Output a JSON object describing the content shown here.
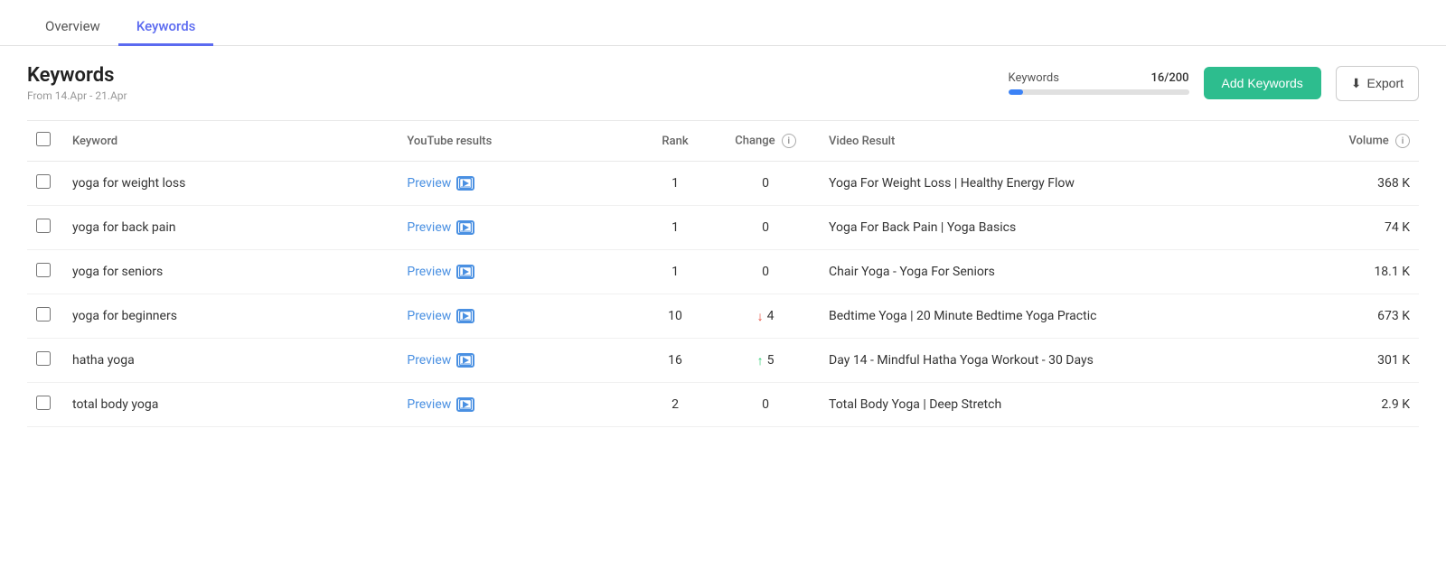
{
  "tabs": [
    {
      "id": "overview",
      "label": "Overview",
      "active": false
    },
    {
      "id": "keywords",
      "label": "Keywords",
      "active": true
    }
  ],
  "page": {
    "title": "Keywords",
    "date_range": "From 14.Apr - 21.Apr"
  },
  "keywords_counter": {
    "label": "Keywords",
    "current": "16/200",
    "progress_percent": 8
  },
  "buttons": {
    "add_keywords": "Add Keywords",
    "export": "Export"
  },
  "table": {
    "columns": [
      {
        "id": "checkbox",
        "label": ""
      },
      {
        "id": "keyword",
        "label": "Keyword"
      },
      {
        "id": "youtube_results",
        "label": "YouTube results"
      },
      {
        "id": "rank",
        "label": "Rank"
      },
      {
        "id": "change",
        "label": "Change"
      },
      {
        "id": "video_result",
        "label": "Video Result"
      },
      {
        "id": "volume",
        "label": "Volume"
      }
    ],
    "rows": [
      {
        "keyword": "yoga for weight loss",
        "rank": "1",
        "change_value": "0",
        "change_direction": "none",
        "video_result": "Yoga For Weight Loss | Healthy Energy Flow",
        "volume": "368 K"
      },
      {
        "keyword": "yoga for back pain",
        "rank": "1",
        "change_value": "0",
        "change_direction": "none",
        "video_result": "Yoga For Back Pain | Yoga Basics",
        "volume": "74 K"
      },
      {
        "keyword": "yoga for seniors",
        "rank": "1",
        "change_value": "0",
        "change_direction": "none",
        "video_result": "Chair Yoga - Yoga For Seniors",
        "volume": "18.1 K"
      },
      {
        "keyword": "yoga for beginners",
        "rank": "10",
        "change_value": "4",
        "change_direction": "down",
        "video_result": "Bedtime Yoga | 20 Minute Bedtime Yoga Practic",
        "volume": "673 K"
      },
      {
        "keyword": "hatha yoga",
        "rank": "16",
        "change_value": "5",
        "change_direction": "up",
        "video_result": "Day 14 - Mindful Hatha Yoga Workout - 30 Days",
        "volume": "301 K"
      },
      {
        "keyword": "total body yoga",
        "rank": "2",
        "change_value": "0",
        "change_direction": "none",
        "video_result": "Total Body Yoga | Deep Stretch",
        "volume": "2.9 K"
      }
    ],
    "preview_label": "Preview"
  },
  "colors": {
    "tab_active": "#5b6af0",
    "progress_fill": "#3b82f6",
    "btn_add_bg": "#2dbd8e",
    "preview_link": "#4a90e2",
    "arrow_down": "#e74c3c",
    "arrow_up": "#2ecc71"
  }
}
